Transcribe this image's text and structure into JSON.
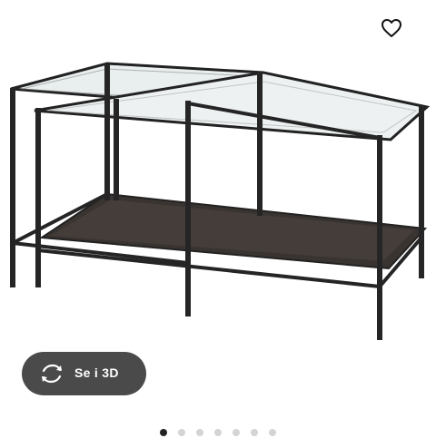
{
  "favorite": {
    "icon": "heart-outline-icon"
  },
  "product_image": {
    "subject": "nesting-tables-glass-black"
  },
  "view_3d_button": {
    "label": "Se i 3D",
    "icon": "rotate-3d-icon",
    "color": "#4a4a4a"
  },
  "carousel": {
    "count": 7,
    "active_index": 0
  }
}
